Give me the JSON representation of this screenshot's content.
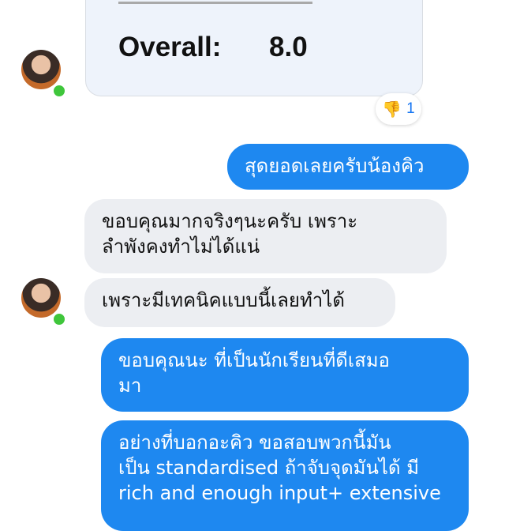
{
  "score_card": {
    "label": "Overall:",
    "value": "8.0"
  },
  "reaction": {
    "emoji": "👎",
    "count": "1"
  },
  "messages": [
    {
      "text": "สุดยอดเลยครับน้องคิว",
      "sender": "me"
    },
    {
      "text": "ขอบคุณมากจริงๆนะครับ เพราะ\nลำพังคงทำไม่ได้แน่",
      "sender": "other"
    },
    {
      "text": "เพราะมีเทคนิคแบบนี้เลยทำได้",
      "sender": "other"
    },
    {
      "text": "ขอบคุณนะ ที่เป็นนักเรียนที่ดีเสมอ\nมา",
      "sender": "me"
    },
    {
      "text": "อย่างที่บอกอะคิว ขอสอบพวกนี้มัน\nเป็น standardised ถ้าจับจุดมันได้ มี\nrich and enough input+ extensive",
      "sender": "me"
    }
  ],
  "colors": {
    "sent_bubble": "#1e88f0",
    "received_bubble": "#eceef2",
    "online": "#3fc63b"
  }
}
